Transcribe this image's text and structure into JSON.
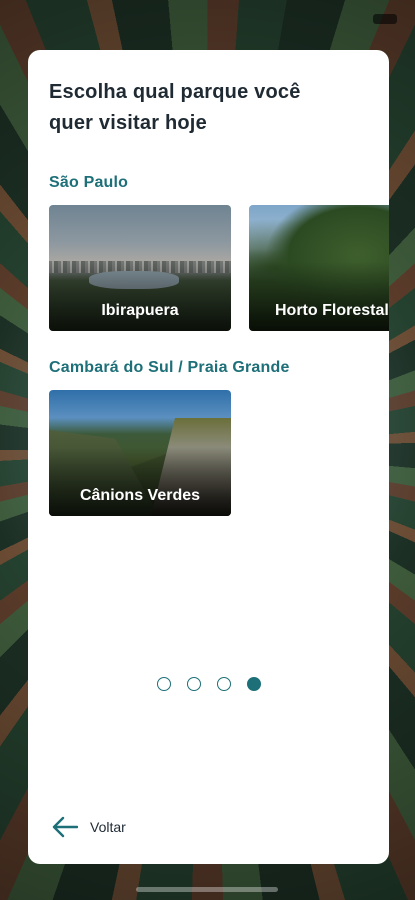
{
  "page": {
    "title": "Escolha qual parque você quer visitar hoje"
  },
  "sections": [
    {
      "label": "São Paulo",
      "parks": [
        {
          "name": "Ibirapuera"
        },
        {
          "name": "Horto Florestal"
        }
      ]
    },
    {
      "label": "Cambará do Sul / Praia Grande",
      "parks": [
        {
          "name": "Cânions Verdes"
        }
      ]
    }
  ],
  "pagination": {
    "total": 4,
    "current": 4
  },
  "navigation": {
    "back_label": "Voltar",
    "back_icon": "arrow-left-icon"
  },
  "colors": {
    "accent": "#1d6f78",
    "card_background": "#ffffff",
    "title_text": "#1f2a33"
  }
}
